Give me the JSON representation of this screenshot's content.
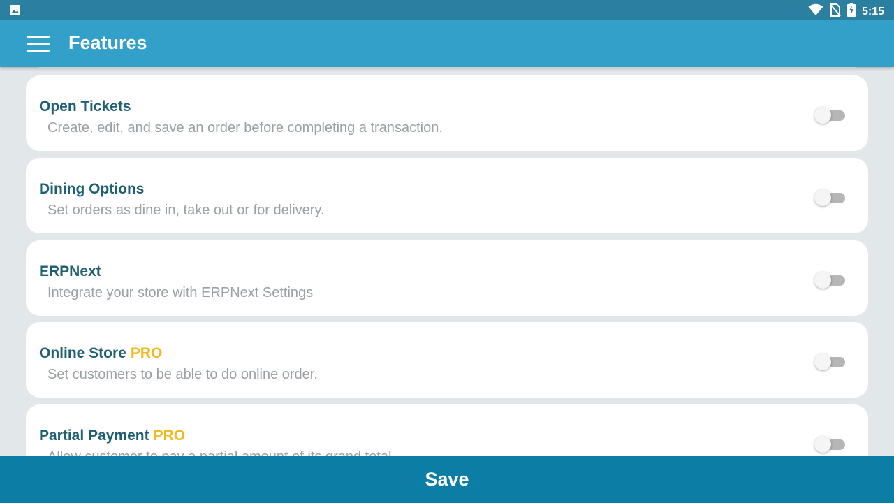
{
  "status_bar": {
    "time": "5:15",
    "icons": [
      "image-icon",
      "wifi-icon",
      "no-sim-icon",
      "battery-charging-icon"
    ]
  },
  "app_bar": {
    "title": "Features",
    "menu_icon": "hamburger-menu-icon"
  },
  "features": [
    {
      "title": "Open Tickets",
      "pro": "",
      "description": "Create, edit, and save an order before completing a transaction.",
      "enabled": false
    },
    {
      "title": "Dining Options",
      "pro": "",
      "description": "Set orders as dine in, take out or for delivery.",
      "enabled": false
    },
    {
      "title": "ERPNext",
      "pro": "",
      "description": "Integrate your store with ERPNext Settings",
      "enabled": false
    },
    {
      "title": "Online Store",
      "pro": "PRO",
      "description": "Set customers to be able to do online order.",
      "enabled": false
    },
    {
      "title": "Partial Payment",
      "pro": "PRO",
      "description": "Allow customer to pay a partial amount of its grand total.",
      "enabled": false
    }
  ],
  "colors": {
    "status_bar": "#2b7fa0",
    "app_bar": "#33a0c9",
    "feature_title": "#1e5f72",
    "pro_badge": "#f1b91f",
    "save_bar": "#0c7ea5"
  },
  "save_button": {
    "label": "Save"
  }
}
